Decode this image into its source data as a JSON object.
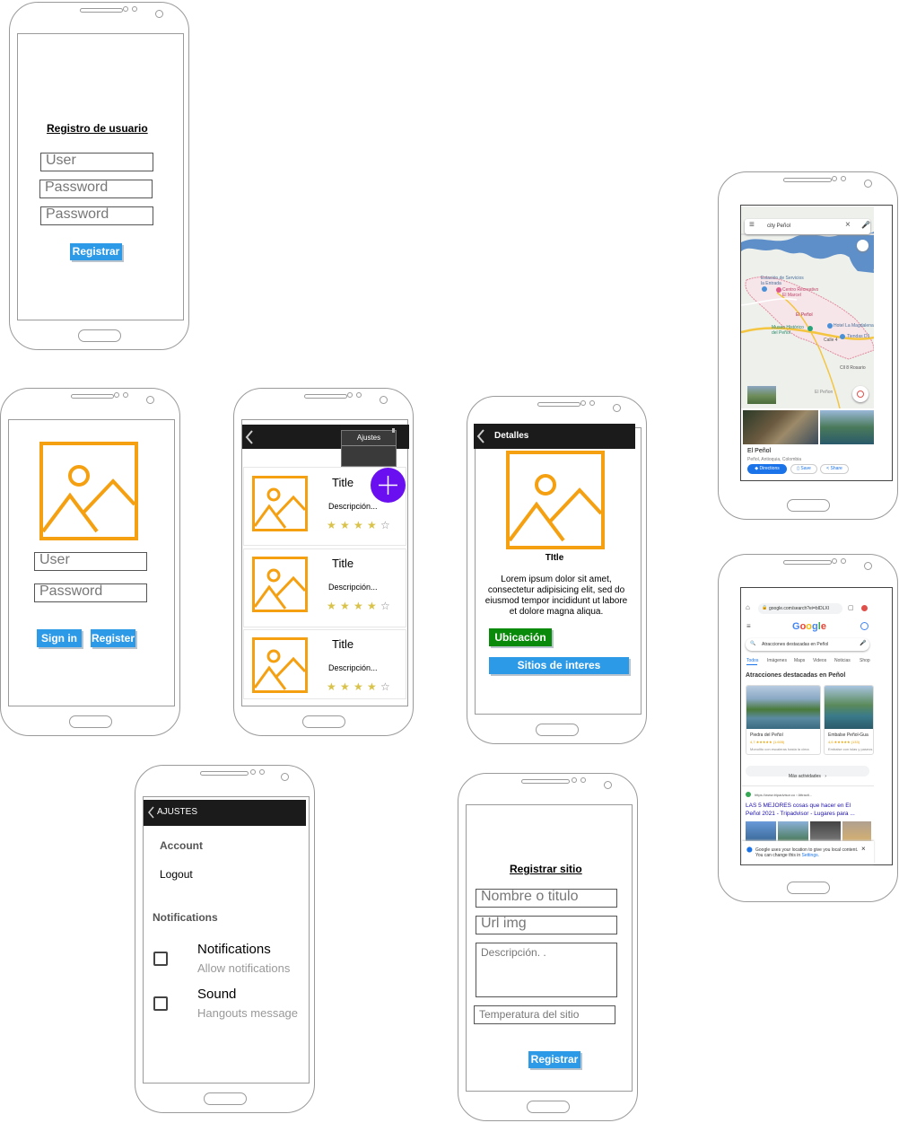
{
  "register_user": {
    "title": "Registro de usuario",
    "user_placeholder": "User",
    "password_placeholder": "Password",
    "password_confirm_placeholder": "Password",
    "register_button": "Registrar"
  },
  "login": {
    "user_placeholder": "User",
    "password_placeholder": "Password",
    "signin_button": "Sign in",
    "register_button": "Register"
  },
  "list": {
    "menu_item": "Ajustes",
    "cards": [
      {
        "title": "Title",
        "description": "Descripción...",
        "rating": 4
      },
      {
        "title": "Title",
        "description": "Descripción...",
        "rating": 4
      },
      {
        "title": "Title",
        "description": "Descripción...",
        "rating": 4
      }
    ]
  },
  "details": {
    "header": "Detalles",
    "title": "TItle",
    "body": "Lorem ipsum dolor sit amet, consectetur adipisicing elit, sed do eiusmod tempor incididunt ut labore et dolore magna aliqua.",
    "location_button": "Ubicación",
    "sites_button": "Sitios de interes"
  },
  "settings": {
    "header": "AJUSTES",
    "account_label": "Account",
    "logout_label": "Logout",
    "notifications_section": "Notifications",
    "items": [
      {
        "title": "Notifications",
        "subtitle": "Allow notifications"
      },
      {
        "title": "Sound",
        "subtitle": "Hangouts message"
      }
    ]
  },
  "register_site": {
    "title": "Registrar sitio",
    "name_placeholder": "Nombre o titulo",
    "url_placeholder": "Url img",
    "description_placeholder": "Descripción. .",
    "temperature_placeholder": "Temperatura del sitio",
    "register_button": "Registrar"
  },
  "maps": {
    "search_text": "city Peñol",
    "labels": {
      "station": "Estación de Servicios la Entrada",
      "center": "Centro Recreativo El Marcel",
      "town": "El Peñol",
      "museum": "Museo Histórico del Peñol",
      "hotel": "Hotel La Magdalena",
      "shop": "Tiendas D1",
      "street": "Calle 4",
      "south": "Cll 8 Rosario",
      "corner": "El Peñon"
    },
    "place_name": "El Peñol",
    "place_sub": "Peñol, Antioquia, Colombia",
    "directions_button": "Directions",
    "save_button": "Save",
    "share_button": "Share"
  },
  "google": {
    "url": "google.com/search?ei=bIDLXI",
    "search_query": "Atracciones destacadas en Peñol",
    "tabs": [
      "Todos",
      "Imágenes",
      "Maps",
      "Videos",
      "Noticias",
      "Shop"
    ],
    "section_title": "Atracciones destacadas en Peñol",
    "cards": [
      {
        "name": "Piedra del Peñol",
        "rating": "4,7 ★★★★★ (1.605)",
        "desc": "Monolito con escaleras hasta la cima"
      },
      {
        "name": "Embalse Peñol-Gua",
        "rating": "4,6 ★★★★★ (133)",
        "desc": "Embalse con islas y paseos"
      }
    ],
    "more_button": "Más actividades",
    "result_source": "https://www.tripadvisor.co › Attracti...",
    "result_title": "LAS 5 MEJORES cosas que hacer en El Peñol 2021 - Tripadvisor - Lugares para ...",
    "location_notice": "Google uses your location to give you local content. You can change this in",
    "location_link": "Settings."
  },
  "colors": {
    "accent_blue": "#2d9ae8",
    "image_orange": "#f5a010",
    "fab_purple": "#6a10f0",
    "ubicacion_green": "#0a8a0a",
    "dark_bar": "#1b1b1b"
  }
}
